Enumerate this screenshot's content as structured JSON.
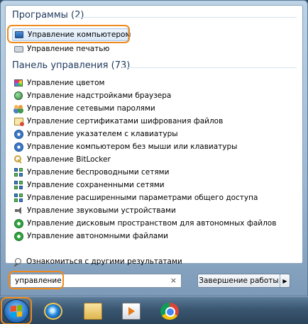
{
  "programs": {
    "header": "Программы (2)",
    "items": [
      {
        "label": "Управление компьютером",
        "icon": "computer-management-icon"
      },
      {
        "label": "Управление печатью",
        "icon": "printer-icon"
      }
    ]
  },
  "control_panel": {
    "header": "Панель управления (73)",
    "items": [
      {
        "label": "Управление цветом",
        "icon": "color-management-icon"
      },
      {
        "label": "Управление надстройками браузера",
        "icon": "browser-addons-icon"
      },
      {
        "label": "Управление сетевыми паролями",
        "icon": "network-passwords-icon"
      },
      {
        "label": "Управление сертификатами шифрования файлов",
        "icon": "certificate-icon"
      },
      {
        "label": "Управление указателем с клавиатуры",
        "icon": "ease-of-access-icon"
      },
      {
        "label": "Управление компьютером без мыши или клавиатуры",
        "icon": "ease-of-access-icon"
      },
      {
        "label": "Управление BitLocker",
        "icon": "bitlocker-key-icon"
      },
      {
        "label": "Управление беспроводными сетями",
        "icon": "network-icon"
      },
      {
        "label": "Управление сохраненными сетями",
        "icon": "network-icon"
      },
      {
        "label": "Управление расширенными параметрами общего доступа",
        "icon": "network-icon"
      },
      {
        "label": "Управление звуковыми устройствами",
        "icon": "speaker-icon"
      },
      {
        "label": "Управление дисковым пространством для автономных файлов",
        "icon": "sync-icon"
      },
      {
        "label": "Управление автономными файлами",
        "icon": "sync-icon"
      }
    ]
  },
  "more_results": "Ознакомиться с другими результатами",
  "search": {
    "value": "управление",
    "clear": "×"
  },
  "shutdown": {
    "label": "Завершение работы",
    "arrow": "▶"
  },
  "colors": {
    "highlight_ring": "#f08a1c",
    "header_text": "#1e395b"
  }
}
